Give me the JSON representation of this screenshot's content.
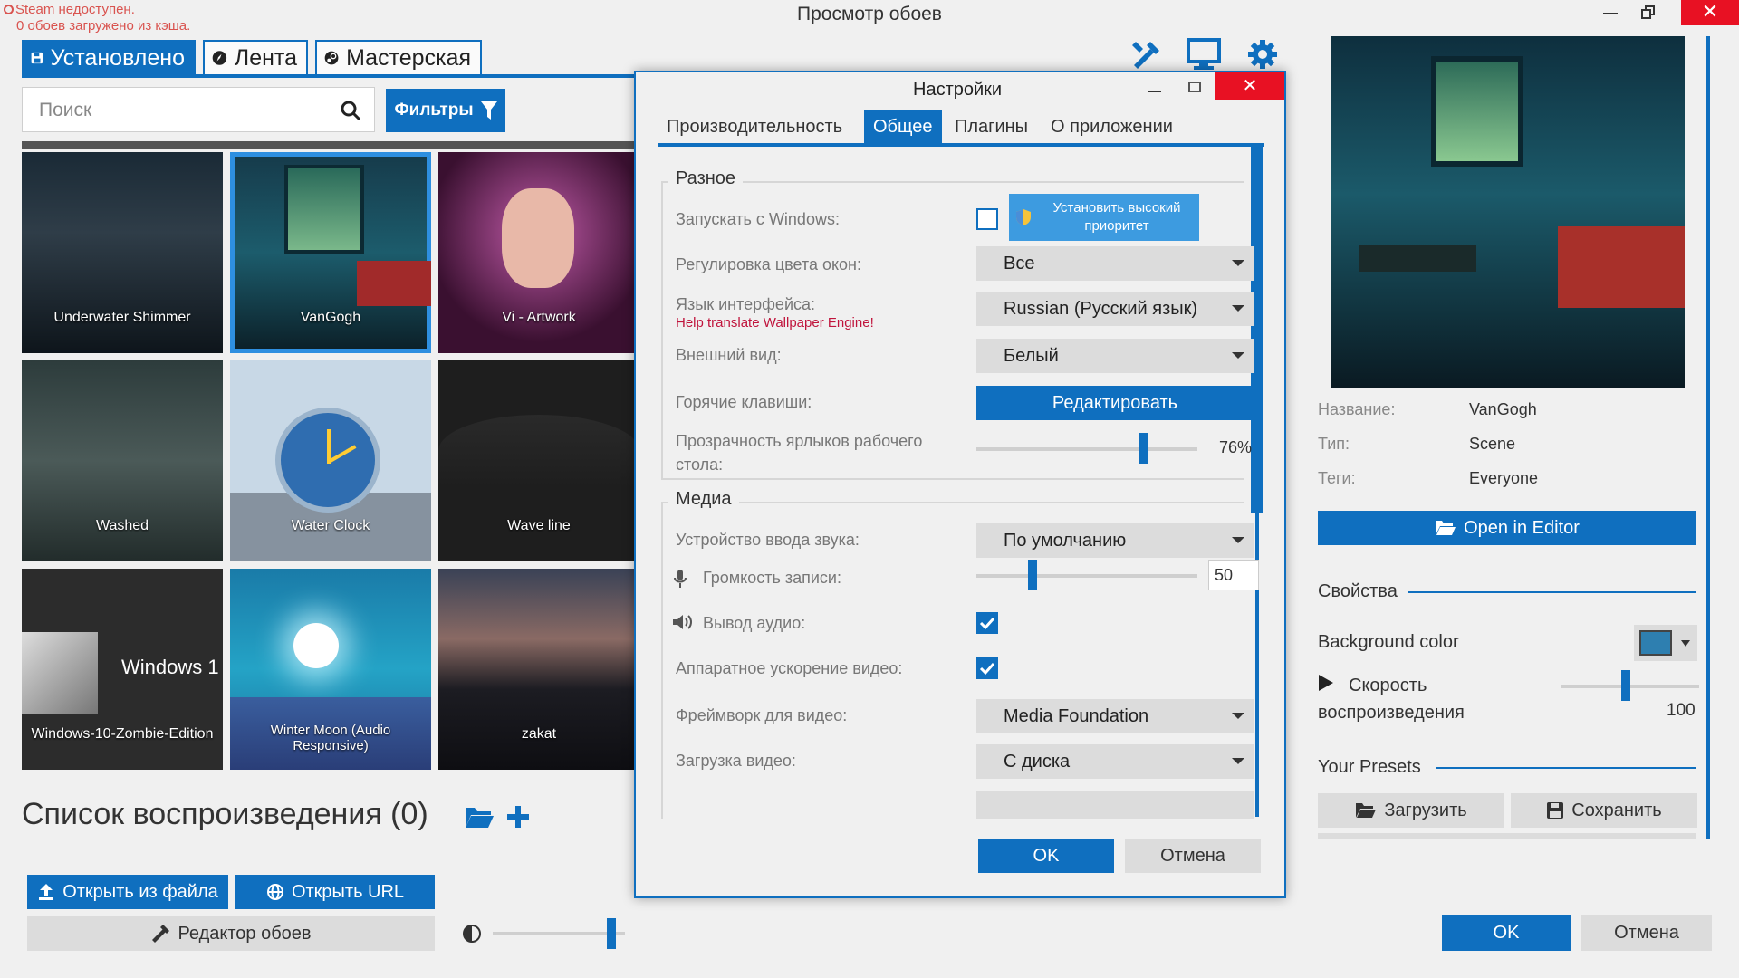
{
  "window": {
    "title": "Просмотр обоев"
  },
  "status": {
    "line1": "Steam недоступен.",
    "line2": "0 обоев загружено из кэша."
  },
  "tabs": [
    {
      "label": "Установлено",
      "icon": "save-icon"
    },
    {
      "label": "Лента",
      "icon": "compass-icon"
    },
    {
      "label": "Мастерская",
      "icon": "steam-icon"
    }
  ],
  "search": {
    "placeholder": "Поиск"
  },
  "filters_label": "Фильтры",
  "wallpapers": [
    {
      "title": "Underwater Shimmer"
    },
    {
      "title": "VanGogh",
      "selected": true
    },
    {
      "title": "Vi - Artwork"
    },
    {
      "title": "Washed"
    },
    {
      "title": "Water Clock"
    },
    {
      "title": "Wave line"
    },
    {
      "title": "Windows-10-Zombie-Edition",
      "overlay_text": "Windows 1"
    },
    {
      "title": "Winter Moon (Audio Responsive)"
    },
    {
      "title": "zakat"
    }
  ],
  "playlist": {
    "title": "Список воспроизведения (0)"
  },
  "bottom": {
    "open_file": "Открыть из файла",
    "open_url": "Открыть URL",
    "editor": "Редактор обоев",
    "brightness": 0.9
  },
  "settings": {
    "title": "Настройки",
    "tabs": [
      "Производительность",
      "Общее",
      "Плагины",
      "О приложении"
    ],
    "active_tab": "Общее",
    "misc": {
      "title": "Разное",
      "start_with_windows": {
        "label": "Запускать с Windows:",
        "checked": false
      },
      "priority_button": "Установить высокий приоритет",
      "window_color": {
        "label": "Регулировка цвета окон:",
        "value": "Все"
      },
      "language": {
        "label": "Язык интерфейса:",
        "link": "Help translate Wallpaper Engine!",
        "value": "Russian (Русский язык)"
      },
      "appearance": {
        "label": "Внешний вид:",
        "value": "Белый"
      },
      "hotkeys": {
        "label": "Горячие клавиши:",
        "button": "Редактировать"
      },
      "icon_opacity": {
        "label": "Прозрачность ярлыков рабочего стола:",
        "value": "76%",
        "fraction": 0.76
      }
    },
    "media": {
      "title": "Медиа",
      "input_device": {
        "label": "Устройство ввода звука:",
        "value": "По умолчанию"
      },
      "rec_volume": {
        "label": "Громкость записи:",
        "value": "50",
        "fraction": 0.5
      },
      "audio_output": {
        "label": "Вывод аудио:",
        "checked": true
      },
      "hw_accel": {
        "label": "Аппаратное ускорение видео:",
        "checked": true
      },
      "video_framework": {
        "label": "Фреймворк для видео:",
        "value": "Media Foundation"
      },
      "video_loading": {
        "label": "Загрузка видео:",
        "value": "С диска"
      }
    },
    "ok": "OK",
    "cancel": "Отмена"
  },
  "details": {
    "name_label": "Название:",
    "name": "VanGogh",
    "type_label": "Тип:",
    "type": "Scene",
    "tags_label": "Теги:",
    "tags": "Everyone",
    "open_editor": "Open in Editor",
    "properties_title": "Свойства",
    "bg_color_label": "Background color",
    "bg_color": "#2e7fb0",
    "speed_label": "Скорость воспроизведения",
    "speed_value": "100",
    "presets_title": "Your Presets",
    "load": "Загрузить",
    "save": "Сохранить"
  },
  "footer": {
    "ok": "OK",
    "cancel": "Отмена"
  },
  "colors": {
    "accent": "#0f6fbf",
    "link": "#c0143c"
  }
}
